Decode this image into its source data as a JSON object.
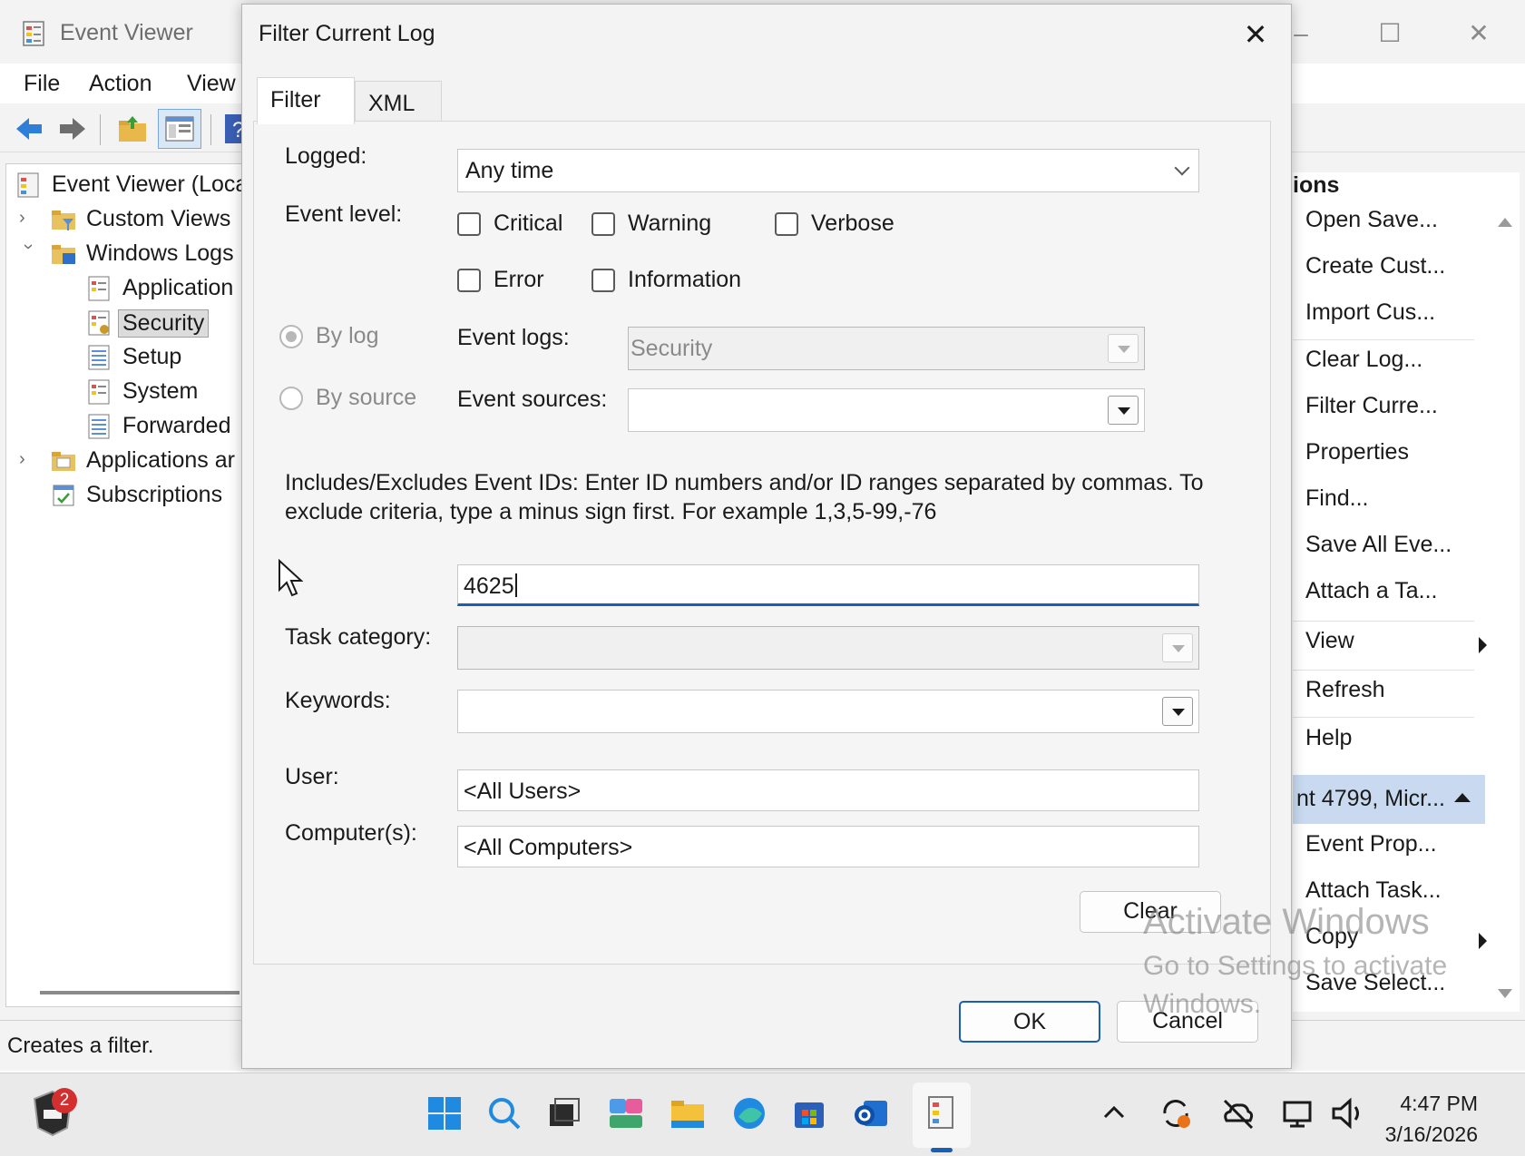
{
  "main_window": {
    "title": "Event Viewer",
    "menu": [
      "File",
      "Action",
      "View"
    ],
    "status_text": "Creates a filter."
  },
  "tree": {
    "items": [
      {
        "label": "Event Viewer (Loca",
        "indent": 0
      },
      {
        "label": "Custom Views",
        "indent": 1
      },
      {
        "label": "Windows Logs",
        "indent": 1
      },
      {
        "label": "Application",
        "indent": 2
      },
      {
        "label": "Security",
        "indent": 2
      },
      {
        "label": "Setup",
        "indent": 2
      },
      {
        "label": "System",
        "indent": 2
      },
      {
        "label": "Forwarded",
        "indent": 2
      },
      {
        "label": "Applications ar",
        "indent": 1
      },
      {
        "label": "Subscriptions",
        "indent": 1
      }
    ]
  },
  "actions": {
    "header": "ions",
    "items": [
      "Open Save...",
      "Create Cust...",
      "Import Cus...",
      "Clear Log...",
      "Filter Curre...",
      "Properties",
      "Find...",
      "Save All Eve...",
      "Attach a Ta...",
      "View",
      "Refresh",
      "Help"
    ],
    "event_header": "nt 4799, Micr...",
    "event_items": [
      "Event Prop...",
      "Attach Task...",
      "Copy",
      "Save Select..."
    ]
  },
  "dialog": {
    "title": "Filter Current Log",
    "close_glyph": "✕",
    "tabs": [
      "Filter",
      "XML"
    ],
    "logged_label": "Logged:",
    "logged_value": "Any time",
    "event_level_label": "Event level:",
    "levels": {
      "critical": "Critical",
      "warning": "Warning",
      "verbose": "Verbose",
      "error": "Error",
      "information": "Information"
    },
    "by_log_label": "By log",
    "by_source_label": "By source",
    "event_logs_label": "Event logs:",
    "event_logs_value": "Security",
    "event_sources_label": "Event sources:",
    "event_sources_value": "",
    "ids_help_line1": "Includes/Excludes Event IDs: Enter ID numbers and/or ID ranges separated by commas. To",
    "ids_help_line2": "exclude criteria, type a minus sign first. For example 1,3,5-99,-76",
    "event_id_value": "4625",
    "task_category_label": "Task category:",
    "keywords_label": "Keywords:",
    "user_label": "User:",
    "user_value": "<All Users>",
    "computers_label": "Computer(s):",
    "computers_value": "<All Computers>",
    "clear_button": "Clear",
    "ok_button": "OK",
    "cancel_button": "Cancel"
  },
  "watermark": {
    "line1": "Activate Windows",
    "line2": "Go to Settings to activate",
    "line3": "Windows."
  },
  "taskbar": {
    "badge_count": "2",
    "time": "4:47 PM",
    "date": "3/16/2026"
  }
}
